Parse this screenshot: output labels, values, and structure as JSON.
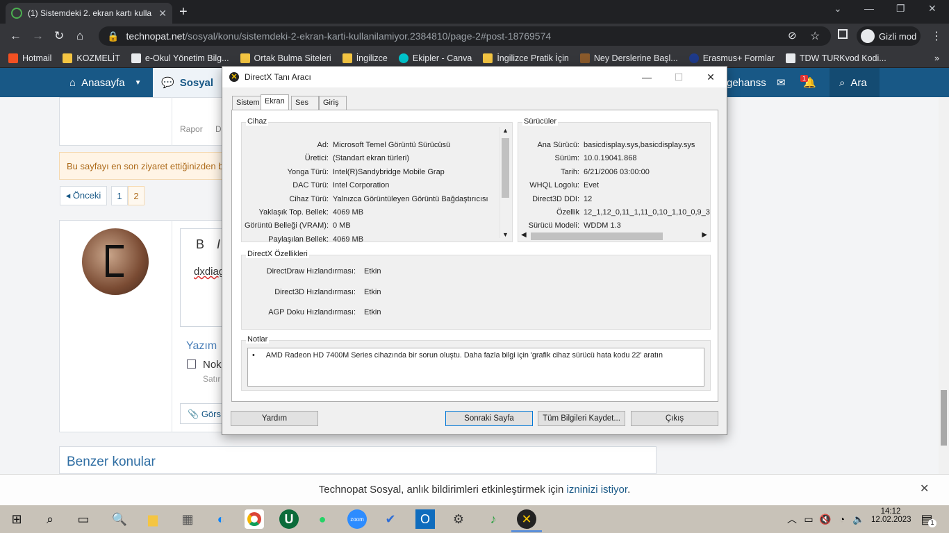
{
  "browser": {
    "tab_title": "(1) Sistemdeki 2. ekran kartı kulla",
    "url_host": "technopat.net",
    "url_path": "/sosyal/konu/sistemdeki-2-ekran-karti-kullanilamiyor.2384810/page-2#post-18769574",
    "incognito_label": "Gizli mod",
    "bookmarks": [
      "Hotmail",
      "KOZMELİT",
      "e-Okul Yönetim Bilg...",
      "Ortak Bulma Siteleri",
      "İngilizce",
      "Ekipler - Canva",
      "İngilizce Pratik İçin",
      "Ney Derslerine Başl...",
      "Erasmus+ Formlar",
      "TDW TURKvod Kodi..."
    ]
  },
  "site": {
    "nav_home": "Anasayfa",
    "nav_social": "Sosyal",
    "user_fragment": "gehanss",
    "search_label": "Ara",
    "alert_count": "1",
    "report_label": "Rapor",
    "report_next": "D",
    "last_visit_banner": "Bu sayfayı en son ziyaret ettiğinizden b",
    "prev_label": "◂ Önceki",
    "pages": [
      "1",
      "2"
    ],
    "editor_text": "dxdiag",
    "editor_bold": "B",
    "editor_italic": "I",
    "write_label": "Yazım",
    "checkbox_label": "Nok",
    "sub_label": "Satır",
    "attach_label": "Görs",
    "similar_topics": "Benzer konular",
    "notification_text": "Technopat Sosyal, anlık bildirimleri etkinleştirmek için",
    "notification_link": "izninizi istiyor",
    "notification_dot": "."
  },
  "dialog": {
    "title": "DirectX Tanı Aracı",
    "tabs": [
      "Sistem",
      "Ekran",
      "Ses",
      "Giriş"
    ],
    "device_group": "Cihaz",
    "device_rows": [
      {
        "label": "Ad:",
        "value": "Microsoft Temel Görüntü Sürücüsü"
      },
      {
        "label": "Üretici:",
        "value": "(Standart ekran türleri)"
      },
      {
        "label": "Yonga Türü:",
        "value": "Intel(R)Sandybridge Mobile Grap"
      },
      {
        "label": "DAC Türü:",
        "value": "Intel Corporation"
      },
      {
        "label": "Cihaz Türü:",
        "value": "Yalnızca Görüntüleyen Görüntü Bağdaştırıcısı"
      },
      {
        "label": "Yaklaşık Top. Bellek:",
        "value": "4069 MB"
      },
      {
        "label": "Görüntü Belleği (VRAM):",
        "value": "0 MB"
      },
      {
        "label": "Paylaşılan Bellek:",
        "value": "4069 MB"
      }
    ],
    "drivers_group": "Sürücüler",
    "driver_rows": [
      {
        "label": "Ana Sürücü:",
        "value": "basicdisplay.sys,basicdisplay.sys"
      },
      {
        "label": "Sürüm:",
        "value": "10.0.19041.868"
      },
      {
        "label": "Tarih:",
        "value": "6/21/2006 03:00:00"
      },
      {
        "label": "WHQL Logolu:",
        "value": "Evet"
      },
      {
        "label": "Direct3D DDI:",
        "value": "12"
      },
      {
        "label": "Özellik",
        "value": "12_1,12_0,11_1,11_0,10_1,10_0,9_3"
      },
      {
        "label": "Sürücü Modeli:",
        "value": "WDDM 1.3"
      }
    ],
    "features_group": "DirectX Özellikleri",
    "feature_rows": [
      {
        "label": "DirectDraw Hızlandırması:",
        "value": "Etkin"
      },
      {
        "label": "Direct3D Hızlandırması:",
        "value": "Etkin"
      },
      {
        "label": "AGP Doku Hızlandırması:",
        "value": "Etkin"
      }
    ],
    "notes_group": "Notlar",
    "note_text": "AMD Radeon HD 7400M Series cihazında bir sorun oluştu. Daha fazla bilgi için 'grafik cihaz sürücü hata kodu 22' aratın",
    "buttons": {
      "help": "Yardım",
      "next": "Sonraki Sayfa",
      "save": "Tüm Bilgileri Kaydet...",
      "exit": "Çıkış"
    }
  },
  "taskbar": {
    "time": "14:12",
    "date": "12.02.2023",
    "notif_count": "1"
  }
}
